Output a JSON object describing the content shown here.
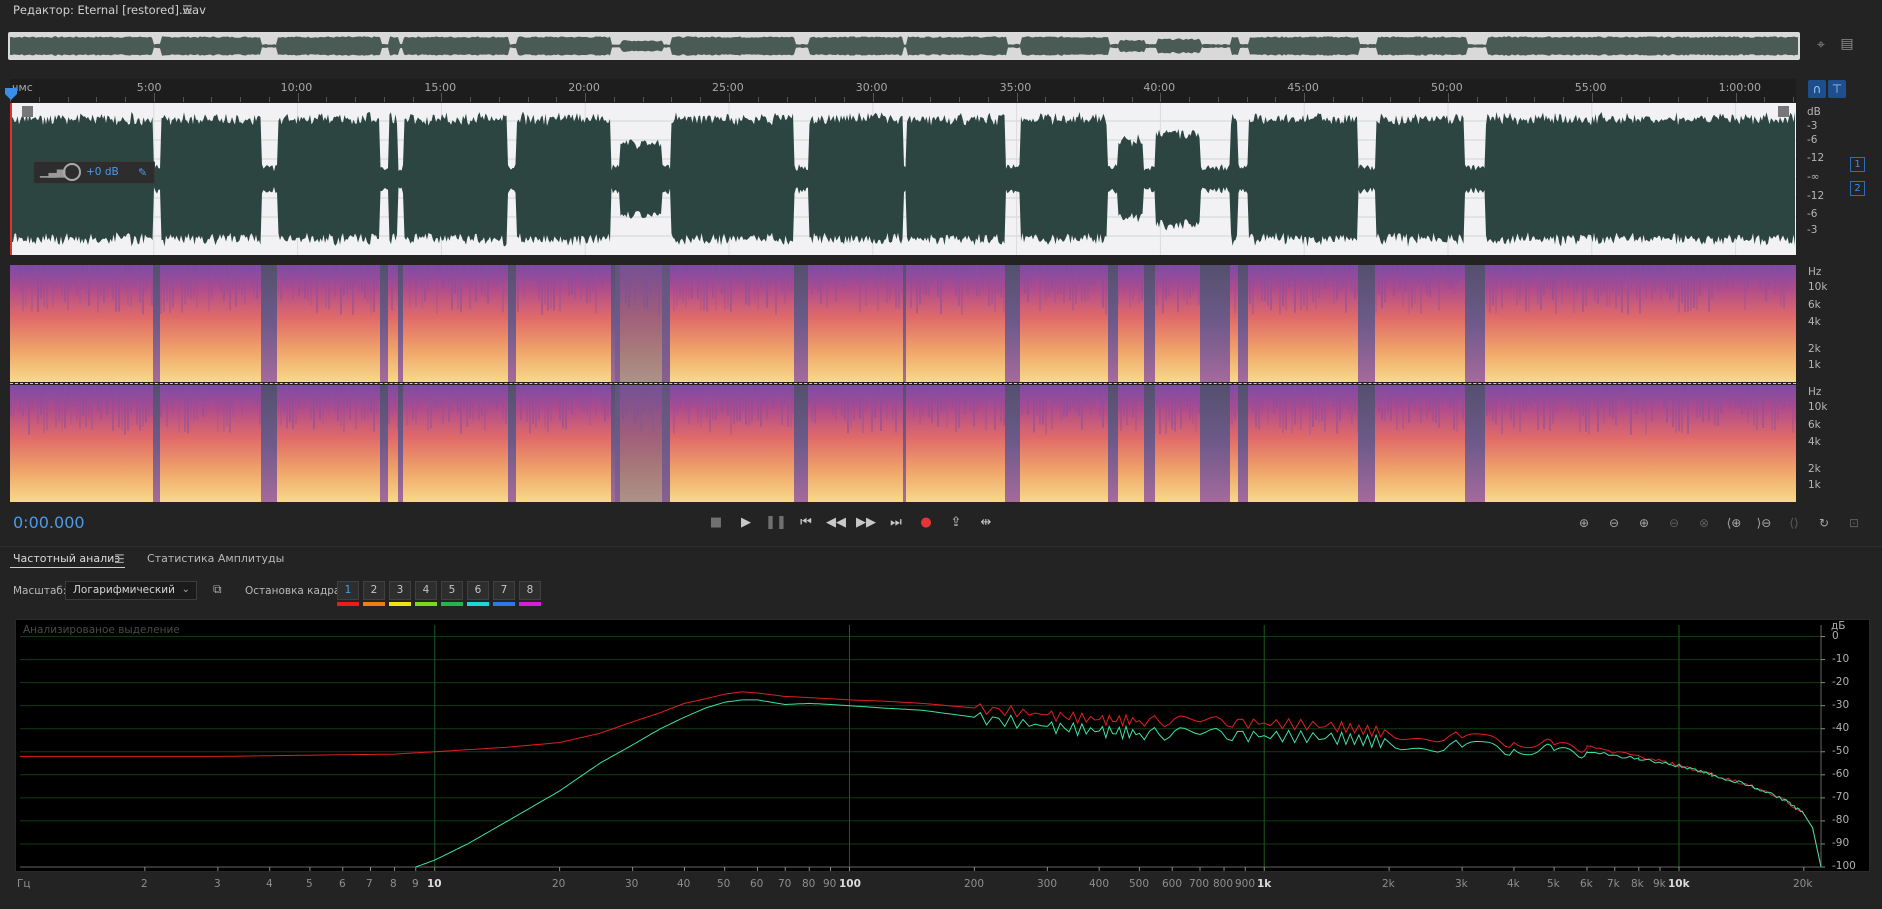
{
  "title_bar": {
    "title": "Редактор: Eternal [restored].wav",
    "menu_icon": "hamburger-menu-icon"
  },
  "ruler": {
    "labels": [
      "чмс",
      "5:00",
      "10:00",
      "15:00",
      "20:00",
      "25:00",
      "30:00",
      "35:00",
      "40:00",
      "45:00",
      "50:00",
      "55:00",
      "1:00:00"
    ]
  },
  "waveform": {
    "db_labels_right": [
      "dB",
      "-3",
      "-6",
      "-12",
      "-∞",
      "-12",
      "-6",
      "-3"
    ],
    "channels": [
      "1",
      "2"
    ],
    "gain_value": "+0 dB"
  },
  "spectrum_panels": {
    "unit": "Hz",
    "labels": [
      "10k",
      "6k",
      "4k",
      "2k",
      "1k"
    ]
  },
  "transport": {
    "time": "0:00.000"
  },
  "tabs": {
    "frequency_analysis": "Частотный анализ",
    "amplitude_stats": "Статистика Амплитуды"
  },
  "controls": {
    "scale_label": "Масштаб:",
    "scale_value": "Логарифмический",
    "freeze_label": "Остановка кадра:",
    "frames": [
      {
        "label": "1",
        "color": "#e81c1c"
      },
      {
        "label": "2",
        "color": "#f07c14"
      },
      {
        "label": "3",
        "color": "#f0e314"
      },
      {
        "label": "4",
        "color": "#7bd81c"
      },
      {
        "label": "5",
        "color": "#22b54b"
      },
      {
        "label": "6",
        "color": "#1cd7d7"
      },
      {
        "label": "7",
        "color": "#2b78e8"
      },
      {
        "label": "8",
        "color": "#d81ed8"
      }
    ]
  },
  "chart_data": {
    "type": "line",
    "caption": "Анализированое выделение",
    "xlabel": "Гц",
    "ylabel": "дБ",
    "x_ticks": [
      "2",
      "3",
      "4",
      "5",
      "6",
      "7",
      "8",
      "9",
      "10",
      "20",
      "30",
      "40",
      "50",
      "60",
      "70",
      "80",
      "90",
      "100",
      "200",
      "300",
      "400",
      "500",
      "600",
      "700",
      "800",
      "900",
      "1k",
      "2k",
      "3k",
      "4k",
      "5k",
      "6k",
      "7k",
      "8k",
      "9k",
      "10k",
      "20k"
    ],
    "y_ticks": [
      "0",
      "-10",
      "-20",
      "-30",
      "-40",
      "-50",
      "-60",
      "-70",
      "-80",
      "-90",
      "-100"
    ],
    "x_scale": "log",
    "xlim": [
      1,
      22000
    ],
    "ylim": [
      -100,
      5
    ],
    "grid": true,
    "series": [
      {
        "color": "#e02020",
        "x": [
          1,
          3,
          5,
          8,
          10,
          15,
          20,
          25,
          30,
          35,
          40,
          45,
          50,
          55,
          60,
          70,
          80,
          90,
          100,
          120,
          150,
          200,
          300,
          400,
          500,
          700,
          1000,
          1500,
          2000,
          3000,
          4000,
          5000,
          6000,
          8000,
          10000,
          12000,
          15000,
          18000,
          20000,
          21000,
          22000
        ],
        "y": [
          -52,
          -52,
          -51.5,
          -51,
          -50,
          -48,
          -46,
          -42,
          -37,
          -33,
          -29,
          -27,
          -25,
          -24,
          -24.5,
          -26,
          -26.5,
          -27,
          -27.5,
          -28,
          -29,
          -31,
          -34,
          -36,
          -36.5,
          -37,
          -37.5,
          -39,
          -42,
          -44,
          -46,
          -47,
          -48,
          -52,
          -56,
          -60,
          -65,
          -71,
          -77,
          -83,
          -100
        ]
      },
      {
        "color": "#3fe0a6",
        "x": [
          9,
          10,
          12,
          15,
          20,
          25,
          30,
          35,
          40,
          45,
          50,
          55,
          60,
          70,
          80,
          90,
          100,
          120,
          150,
          200,
          300,
          400,
          500,
          700,
          1000,
          1500,
          2000,
          3000,
          4000,
          5000,
          6000,
          8000,
          10000,
          12000,
          15000,
          18000,
          20000,
          21000,
          22000
        ],
        "y": [
          -100,
          -97,
          -90,
          -80,
          -67,
          -55,
          -47,
          -40,
          -35,
          -31,
          -28.5,
          -27.5,
          -27.5,
          -29.5,
          -29,
          -29.5,
          -30,
          -31,
          -32,
          -35,
          -39,
          -41,
          -42,
          -42.5,
          -43,
          -44,
          -46,
          -48,
          -49,
          -49.5,
          -50,
          -53,
          -56,
          -60,
          -65,
          -71,
          -77,
          -83,
          -100
        ]
      }
    ]
  }
}
